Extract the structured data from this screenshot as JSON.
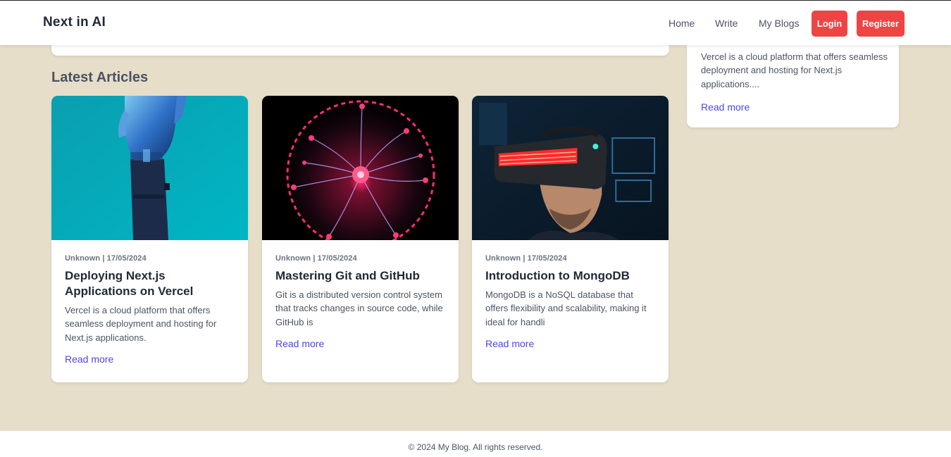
{
  "header": {
    "brand": "Next in AI",
    "nav": {
      "home": "Home",
      "write": "Write",
      "my_blogs": "My Blogs"
    },
    "login_label": "Login",
    "register_label": "Register"
  },
  "side_card": {
    "excerpt": "Vercel is a cloud platform that offers seamless deployment and hosting for Next.js applications....",
    "read_more": "Read more"
  },
  "section_title": "Latest Articles",
  "articles": [
    {
      "meta": "Unknown | 17/05/2024",
      "title": "Deploying Next.js Applications on Vercel",
      "excerpt": "Vercel is a cloud platform that offers seamless deployment and hosting for Next.js applications.",
      "read_more": "Read more",
      "image": "robot-hand-image"
    },
    {
      "meta": "Unknown | 17/05/2024",
      "title": "Mastering Git and GitHub",
      "excerpt": "Git is a distributed version control system that tracks changes in source code, while GitHub is",
      "read_more": "Read more",
      "image": "plasma-ball-image"
    },
    {
      "meta": "Unknown | 17/05/2024",
      "title": "Introduction to MongoDB",
      "excerpt": "MongoDB is a NoSQL database that offers flexibility and scalability, making it ideal for handli",
      "read_more": "Read more",
      "image": "vr-headset-image"
    }
  ],
  "footer": {
    "text": "© 2024 My Blog. All rights reserved."
  },
  "colors": {
    "background": "#e6dec9",
    "accent_button": "#ef4444",
    "link": "#4f46e5"
  }
}
